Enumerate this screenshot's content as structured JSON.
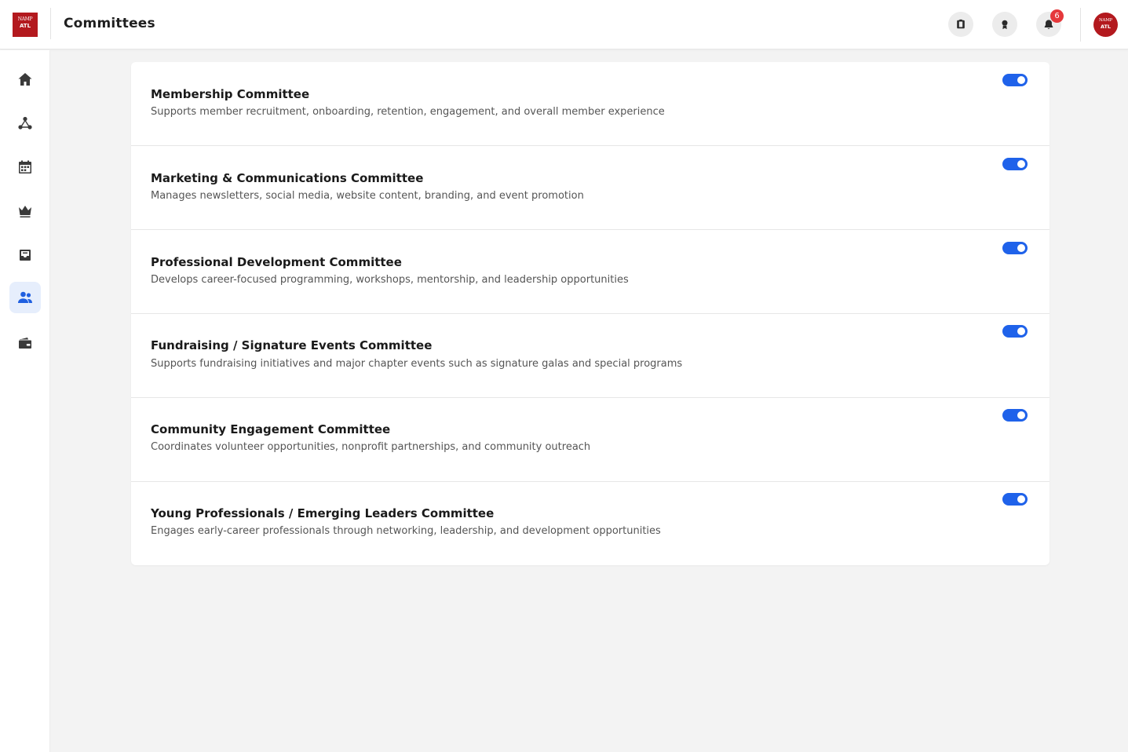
{
  "brand": {
    "logo_line1": "NAMP",
    "logo_line2": "ATL",
    "accent": "#b3191e"
  },
  "header": {
    "title": "Committees",
    "notification_count": "6"
  },
  "header_icons": [
    "badge-id-icon",
    "award-icon",
    "bell-icon"
  ],
  "avatar": {
    "line1": "NAMP",
    "line2": "ATL"
  },
  "sidebar": {
    "items": [
      {
        "icon": "home-icon",
        "active": false
      },
      {
        "icon": "network-icon",
        "active": false
      },
      {
        "icon": "calendar-icon",
        "active": false
      },
      {
        "icon": "crown-icon",
        "active": false
      },
      {
        "icon": "inbox-icon",
        "active": false
      },
      {
        "icon": "users-icon",
        "active": true
      },
      {
        "icon": "wallet-icon",
        "active": false
      }
    ]
  },
  "committees": [
    {
      "title": "Membership Committee",
      "description": "Supports member recruitment, onboarding, retention, engagement, and overall member experience",
      "enabled": true
    },
    {
      "title": "Marketing & Communications Committee",
      "description": "Manages newsletters, social media, website content, branding, and event promotion",
      "enabled": true
    },
    {
      "title": "Professional Development Committee",
      "description": "Develops career-focused programming, workshops, mentorship, and leadership opportunities",
      "enabled": true
    },
    {
      "title": "Fundraising / Signature Events Committee",
      "description": "Supports fundraising initiatives and major chapter events such as signature galas and special programs",
      "enabled": true
    },
    {
      "title": "Community Engagement Committee",
      "description": "Coordinates volunteer opportunities, nonprofit partnerships, and community outreach",
      "enabled": true
    },
    {
      "title": "Young Professionals / Emerging Leaders Committee",
      "description": "Engages early-career professionals through networking, leadership, and development opportunities",
      "enabled": true
    }
  ],
  "colors": {
    "toggle_on": "#1f62ea",
    "active_nav": "#1f5fe0",
    "badge": "#e5383b"
  }
}
